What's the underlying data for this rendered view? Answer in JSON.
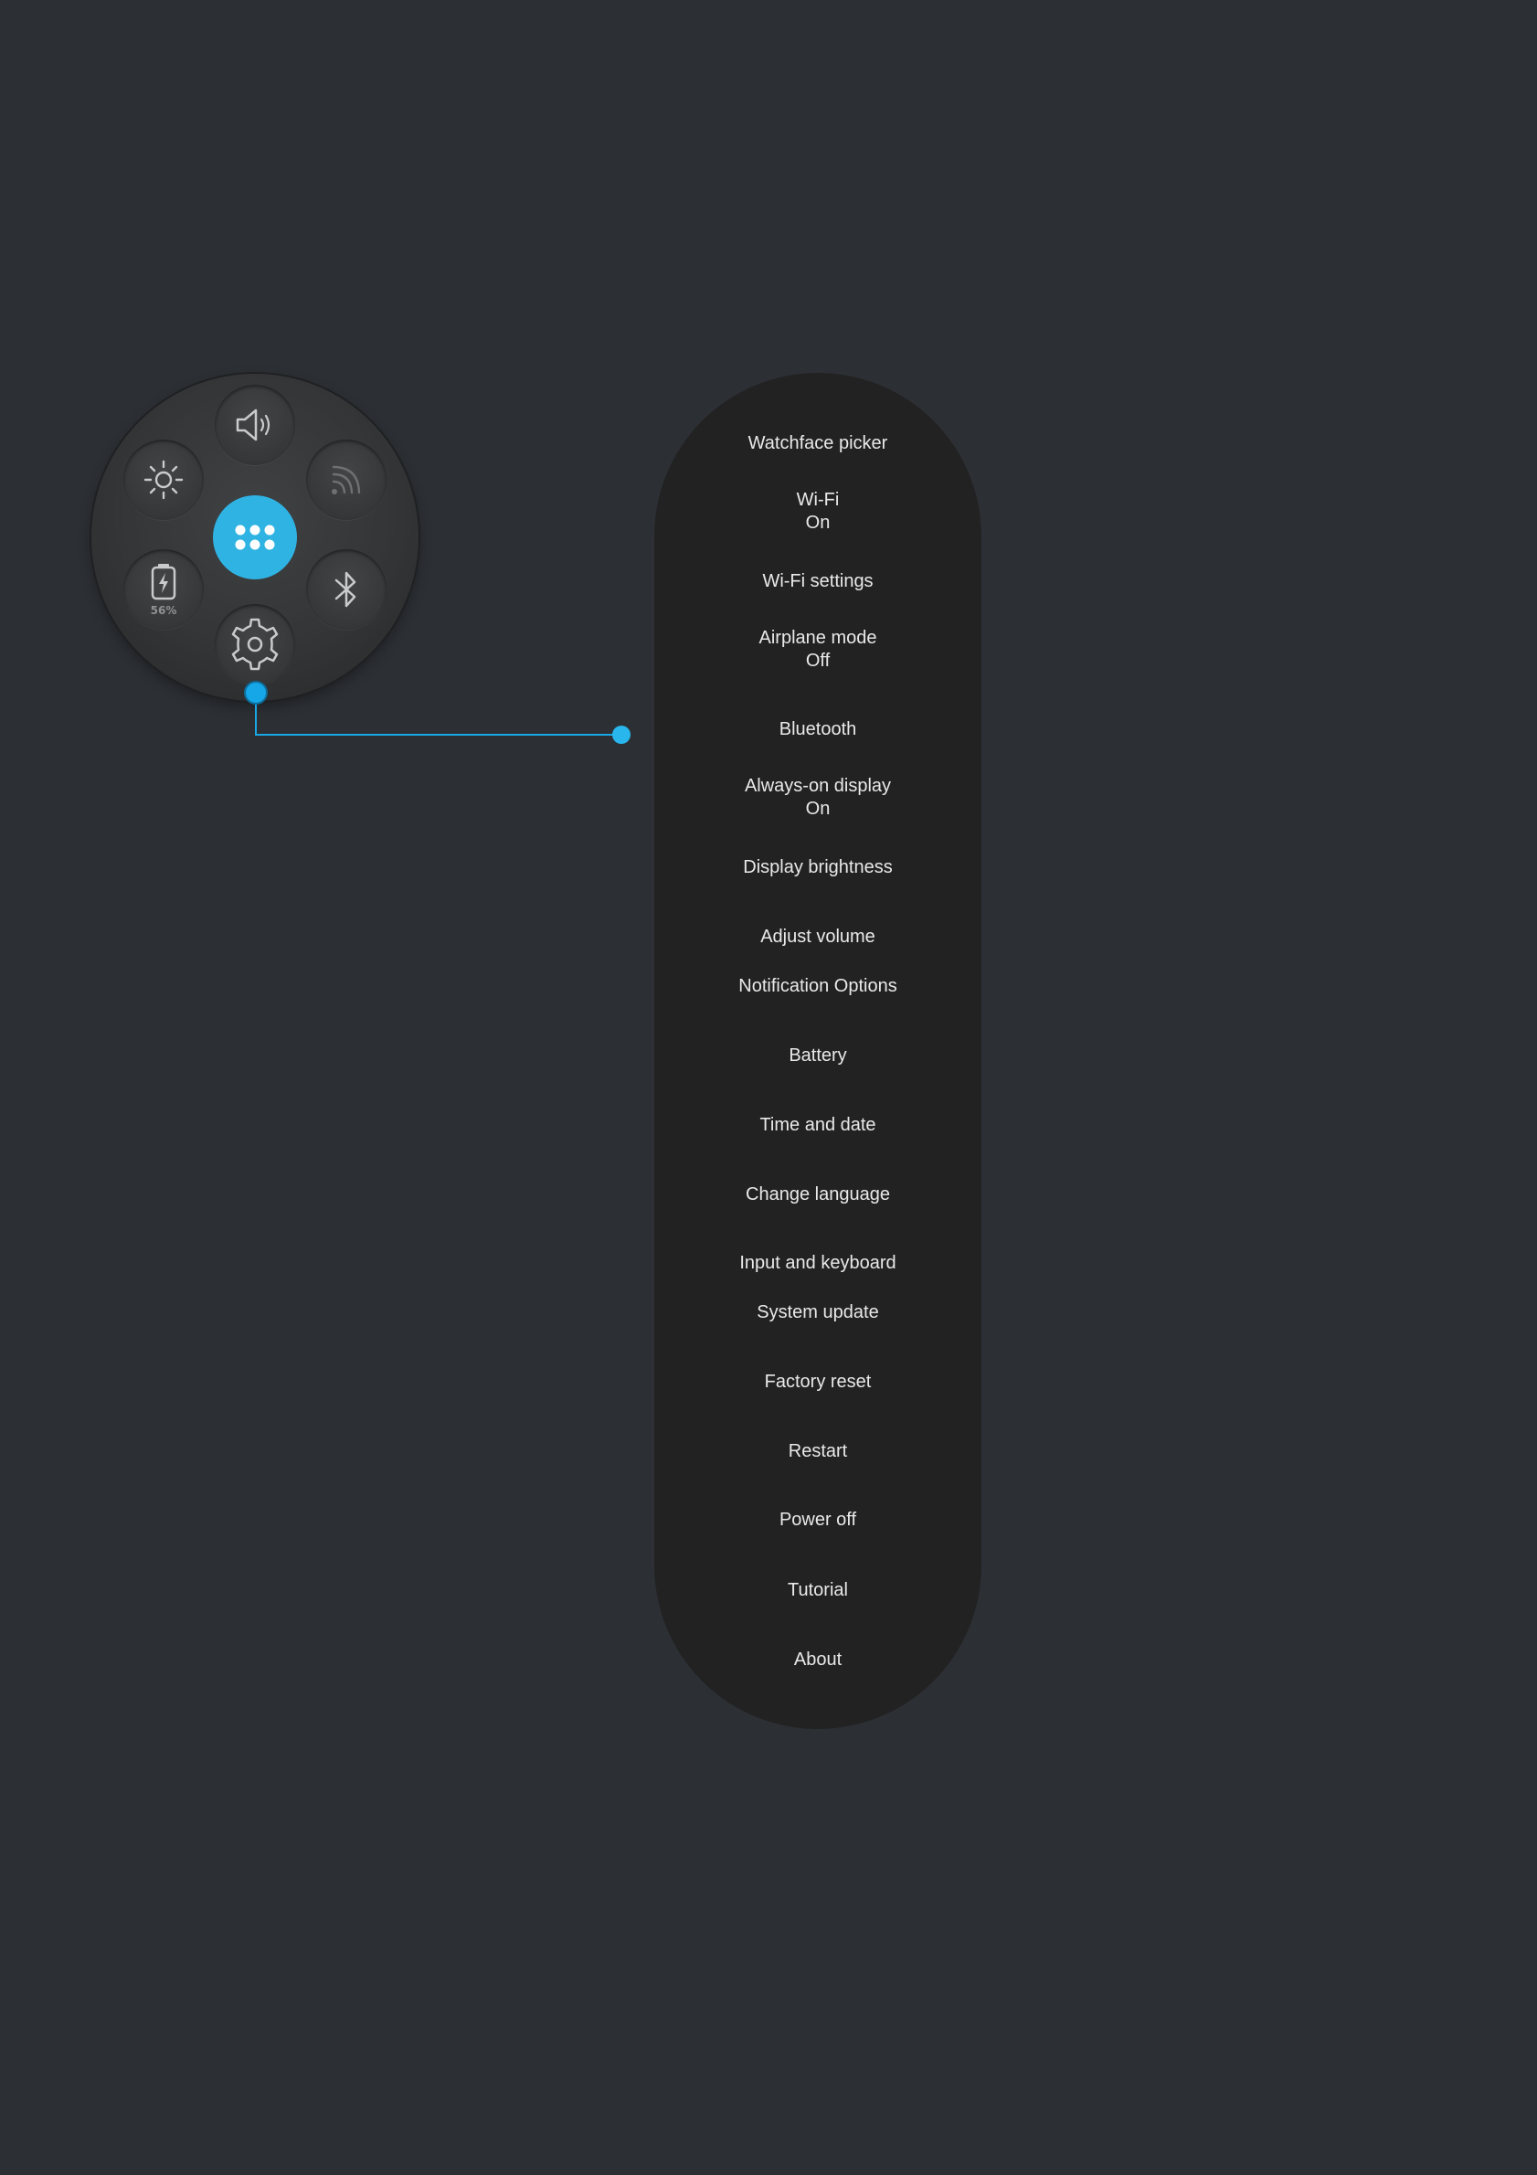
{
  "quick_panel": {
    "battery_percent": "56%",
    "accent_color": "#2fb3e3",
    "buttons": [
      "volume-icon",
      "brightness-icon",
      "nfc-icon",
      "apps-icon",
      "battery-icon",
      "bluetooth-icon",
      "settings-icon"
    ]
  },
  "settings_menu": {
    "items": [
      {
        "label": "Watchface picker",
        "sub": ""
      },
      {
        "label": "Wi-Fi",
        "sub": "On"
      },
      {
        "label": "Wi-Fi settings",
        "sub": ""
      },
      {
        "label": "Airplane mode",
        "sub": "Off"
      },
      {
        "label": "Bluetooth",
        "sub": ""
      },
      {
        "label": "Always-on display",
        "sub": "On"
      },
      {
        "label": "Display brightness",
        "sub": ""
      },
      {
        "label": "Adjust volume",
        "sub": ""
      },
      {
        "label": "Notification Options",
        "sub": ""
      },
      {
        "label": "Battery",
        "sub": ""
      },
      {
        "label": "Time and date",
        "sub": ""
      },
      {
        "label": "Change language",
        "sub": ""
      },
      {
        "label": "Input and keyboard",
        "sub": ""
      },
      {
        "label": "System update",
        "sub": ""
      },
      {
        "label": "Factory reset",
        "sub": ""
      },
      {
        "label": "Restart",
        "sub": ""
      },
      {
        "label": "Power off",
        "sub": ""
      },
      {
        "label": "Tutorial",
        "sub": ""
      },
      {
        "label": "About",
        "sub": ""
      }
    ]
  }
}
